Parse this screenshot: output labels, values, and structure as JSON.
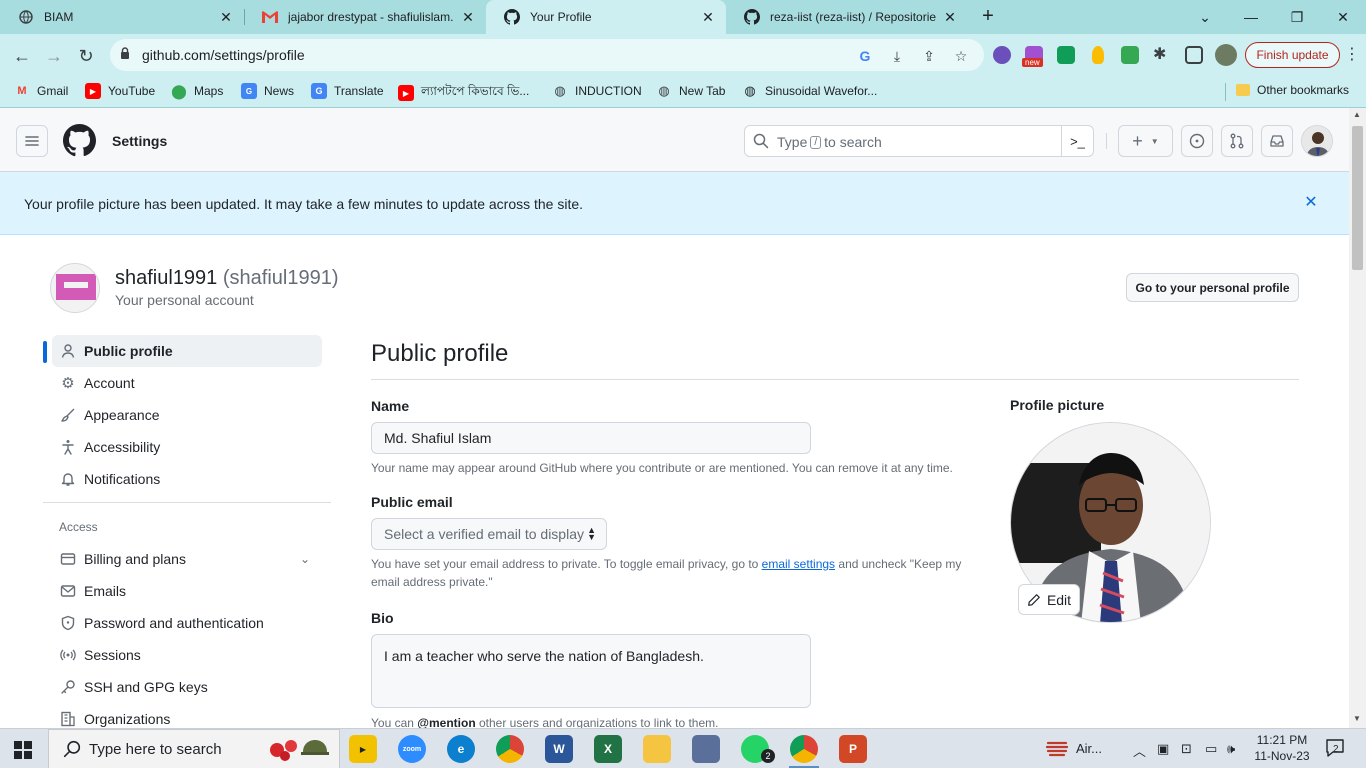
{
  "browser": {
    "tabs": [
      {
        "title": "BIAM",
        "icon": "globe-icon"
      },
      {
        "title": "jajabor drestypat - shafiulislam.m",
        "icon": "gmail-icon"
      },
      {
        "title": "Your Profile",
        "icon": "github-icon",
        "active": true
      },
      {
        "title": "reza-iist (reza-iist) / Repositories",
        "icon": "github-icon"
      }
    ],
    "url": "github.com/settings/profile",
    "finish_update": "Finish update",
    "ext_badge": "new",
    "bookmarks": [
      {
        "label": "Gmail",
        "icon": "gmail-icon"
      },
      {
        "label": "YouTube",
        "icon": "youtube-icon"
      },
      {
        "label": "Maps",
        "icon": "maps-icon"
      },
      {
        "label": "News",
        "icon": "news-icon"
      },
      {
        "label": "Translate",
        "icon": "translate-icon"
      },
      {
        "label": "ল্যাপটপে কিভাবে ভি...",
        "icon": "youtube-icon"
      },
      {
        "label": "INDUCTION",
        "icon": "globe-icon"
      },
      {
        "label": "New Tab",
        "icon": "globe-icon"
      },
      {
        "label": "Sinusoidal Wavefor...",
        "icon": "globe-icon"
      }
    ],
    "other_bookmarks": "Other bookmarks"
  },
  "header": {
    "title": "Settings",
    "search_prefix": "Type",
    "search_key": "/",
    "search_suffix": "to search",
    "new_symbol": "+"
  },
  "flash": {
    "message": "Your profile picture has been updated. It may take a few minutes to update across the site."
  },
  "account": {
    "name": "shafiul1991",
    "handle": "(shafiul1991)",
    "subtitle": "Your personal account",
    "goto_button": "Go to your personal profile"
  },
  "sidebar": {
    "items": [
      {
        "label": "Public profile",
        "icon": "person-icon",
        "active": true
      },
      {
        "label": "Account",
        "icon": "gear-icon"
      },
      {
        "label": "Appearance",
        "icon": "paintbrush-icon"
      },
      {
        "label": "Accessibility",
        "icon": "accessibility-icon"
      },
      {
        "label": "Notifications",
        "icon": "bell-icon"
      }
    ],
    "group_label": "Access",
    "access_items": [
      {
        "label": "Billing and plans",
        "icon": "credit-card-icon"
      },
      {
        "label": "Emails",
        "icon": "mail-icon"
      },
      {
        "label": "Password and authentication",
        "icon": "shield-icon"
      },
      {
        "label": "Sessions",
        "icon": "broadcast-icon"
      },
      {
        "label": "SSH and GPG keys",
        "icon": "key-icon"
      },
      {
        "label": "Organizations",
        "icon": "organization-icon"
      }
    ]
  },
  "main": {
    "title": "Public profile",
    "name_label": "Name",
    "name_value": "Md. Shafiul Islam",
    "name_note": "Your name may appear around GitHub where you contribute or are mentioned. You can remove it at any time.",
    "email_label": "Public email",
    "email_placeholder": "Select a verified email to display",
    "email_note_before": "You have set your email address to private. To toggle email privacy, go to",
    "email_note_link": "email settings",
    "email_note_after": "and uncheck \"Keep my email address private.\"",
    "bio_label": "Bio",
    "bio_value": "I am a teacher who serve the nation of Bangladesh.",
    "bio_note_before": "You can",
    "bio_note_bold": "@mention",
    "bio_note_after": "other users and organizations to link to them.",
    "picture_label": "Profile picture",
    "edit_button": "Edit"
  },
  "taskbar": {
    "search_placeholder": "Type here to search",
    "weather": "Air...",
    "time": "11:21 PM",
    "date": "11-Nov-23",
    "notification_count": "2",
    "whatsapp_badge": "2"
  },
  "colors": {
    "accent": "#0969da",
    "tabstrip": "#a8dde0",
    "flash_bg": "#ddf4ff"
  }
}
